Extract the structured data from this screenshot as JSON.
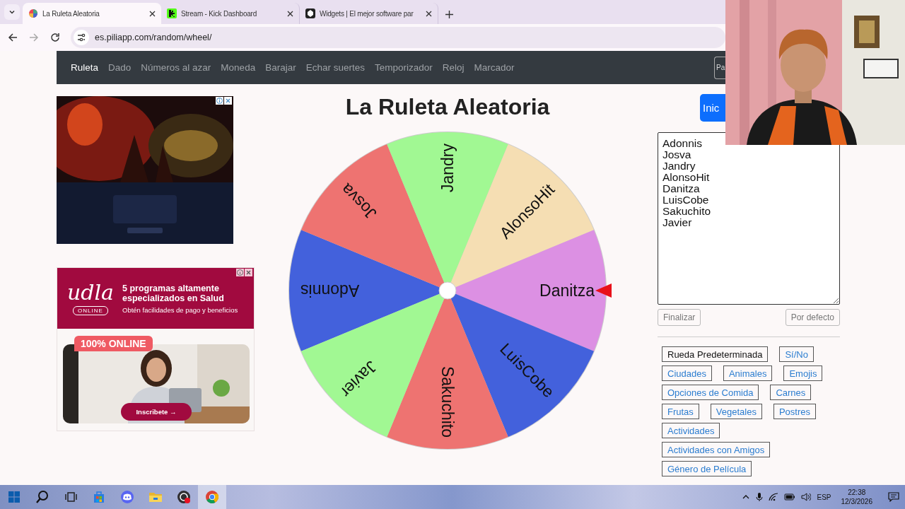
{
  "browser": {
    "tabs": [
      {
        "title": "La Ruleta Aleatoria",
        "selected": true,
        "kind": "wheel"
      },
      {
        "title": "Stream - Kick Dashboard",
        "selected": false,
        "kind": "square"
      },
      {
        "title": "Widgets | El mejor software par",
        "selected": false,
        "kind": "badge"
      }
    ],
    "forward_disabled": true,
    "url": "es.piliapp.com/random/wheel/"
  },
  "navbar": {
    "items": [
      {
        "label": "Ruleta",
        "selected": true
      },
      {
        "label": "Dado",
        "selected": false
      },
      {
        "label": "Números al azar",
        "selected": false
      },
      {
        "label": "Moneda",
        "selected": false
      },
      {
        "label": "Barajar",
        "selected": false
      },
      {
        "label": "Echar suertes",
        "selected": false
      },
      {
        "label": "Temporizador",
        "selected": false
      },
      {
        "label": "Reloj",
        "selected": false
      },
      {
        "label": "Marcador",
        "selected": false
      }
    ],
    "button": "Pa"
  },
  "ad": {
    "logo": "udla",
    "logo_tag": "ONLINE",
    "headline": "5 programas altamente especializados en Salud",
    "subline": "Obtén facilidades de pago y beneficios",
    "badge": "100% ONLINE",
    "cta": "Inscribete →"
  },
  "wheel": {
    "title": "La Ruleta Aleatoria",
    "start_button": "Inic",
    "segments": [
      {
        "label": "Adonnis",
        "color": "#4361dc"
      },
      {
        "label": "Josva",
        "color": "#ee7371"
      },
      {
        "label": "Jandry",
        "color": "#a1f893"
      },
      {
        "label": "AlonsoHit",
        "color": "#f5deb3"
      },
      {
        "label": "Danitza",
        "color": "#dc90e3"
      },
      {
        "label": "LuisCobe",
        "color": "#4361dc"
      },
      {
        "label": "Sakuchito",
        "color": "#ee7371"
      },
      {
        "label": "Javier",
        "color": "#a1f893"
      }
    ]
  },
  "entries": {
    "lines": [
      "Adonnis",
      "Josva",
      "Jandry",
      "AlonsoHit",
      "Danitza",
      "LuisCobe",
      "Sakuchito",
      "Javier"
    ],
    "finish_button": "Finalizar",
    "default_button": "Por defecto"
  },
  "presets": [
    {
      "label": "Rueda Predeterminada",
      "selected": true
    },
    {
      "label": "Sí/No",
      "selected": false
    },
    {
      "label": "Ciudades",
      "selected": false
    },
    {
      "label": "Animales",
      "selected": false
    },
    {
      "label": "Emojis",
      "selected": false
    },
    {
      "label": "Opciones de Comida",
      "selected": false
    },
    {
      "label": "Carnes",
      "selected": false
    },
    {
      "label": "Frutas",
      "selected": false
    },
    {
      "label": "Vegetales",
      "selected": false
    },
    {
      "label": "Postres",
      "selected": false
    },
    {
      "label": "Actividades",
      "selected": false
    },
    {
      "label": "Actividades con Amigos",
      "selected": false
    },
    {
      "label": "Género de Película",
      "selected": false
    }
  ],
  "taskbar": {
    "apps": [
      {
        "kind": "start",
        "active": false
      },
      {
        "kind": "search",
        "active": false
      },
      {
        "kind": "taskview",
        "active": false
      },
      {
        "kind": "store",
        "active": false
      },
      {
        "kind": "chat",
        "active": false
      },
      {
        "kind": "folder",
        "active": false
      },
      {
        "kind": "recorder",
        "active": false
      },
      {
        "kind": "browser",
        "active": true
      }
    ],
    "language": "ESP",
    "time": "22:38",
    "date": "12/3/2026"
  }
}
